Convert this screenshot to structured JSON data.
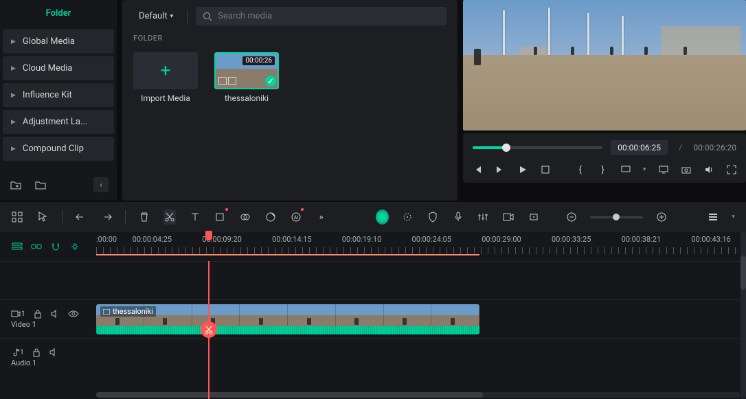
{
  "sidebar": {
    "active_tab": "Folder",
    "items": [
      {
        "label": "Global Media"
      },
      {
        "label": "Cloud Media"
      },
      {
        "label": "Influence Kit"
      },
      {
        "label": "Adjustment La..."
      },
      {
        "label": "Compound Clip"
      }
    ]
  },
  "media_panel": {
    "sort_label": "Default",
    "search_placeholder": "Search media",
    "folder_header": "FOLDER",
    "import_label": "Import Media",
    "clips": [
      {
        "name": "thessaloniki",
        "duration": "00:00:26"
      }
    ]
  },
  "preview": {
    "current_time": "00:00:06:25",
    "total_time": "00:00:26:20"
  },
  "timeline": {
    "ruler_labels": [
      ":00:00",
      "00:00:04:25",
      "00:00:09:20",
      "00:00:14:15",
      "00:00:19:10",
      "00:00:24:05",
      "00:00:29:00",
      "00:00:33:25",
      "00:00:38:21",
      "00:00:43:16"
    ],
    "tracks": {
      "video": {
        "name": "Video 1",
        "index": "1",
        "clip_label": "thessaloniki"
      },
      "audio": {
        "name": "Audio 1",
        "index": "1"
      }
    }
  }
}
